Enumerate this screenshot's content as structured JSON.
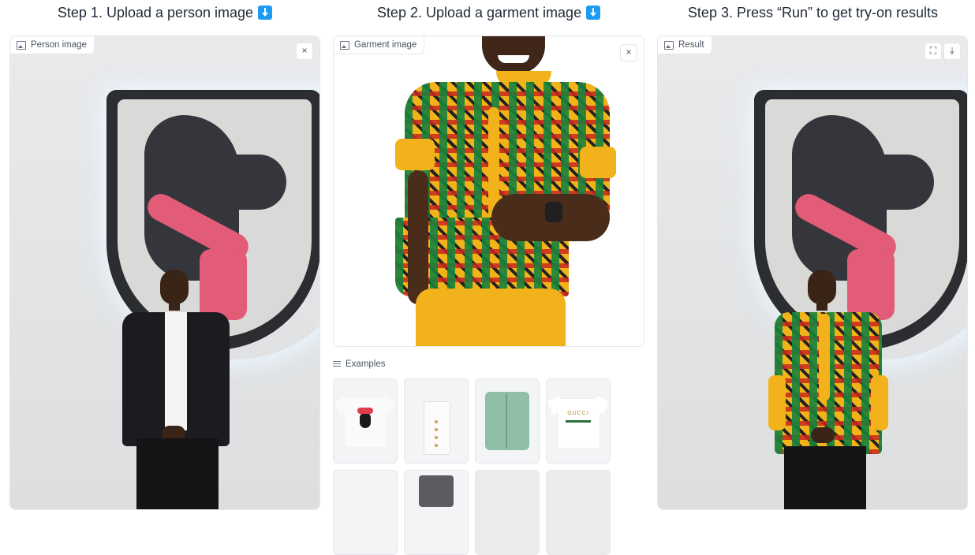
{
  "steps": [
    {
      "title": "Step 1. Upload a person image",
      "icon": "down-arrow-icon"
    },
    {
      "title": "Step 2. Upload a garment image",
      "icon": "down-arrow-icon"
    },
    {
      "title": "Step 3. Press “Run” to get try-on results"
    }
  ],
  "person_panel": {
    "label": "Person image",
    "action": "close-icon",
    "action_glyph": "×"
  },
  "garment_panel": {
    "label": "Garment image",
    "action": "close-icon",
    "action_glyph": "×"
  },
  "result_panel": {
    "label": "Result",
    "actions": [
      {
        "icon": "fullscreen-icon",
        "glyph": "⛶"
      },
      {
        "icon": "download-icon",
        "glyph": "⤓"
      }
    ]
  },
  "examples": {
    "label": "Examples",
    "gucci_logo_text": "GUCCI",
    "items": [
      {
        "name": "minnie-mouse-tshirt"
      },
      {
        "name": "white-button-tank-top"
      },
      {
        "name": "green-denim-jacket"
      },
      {
        "name": "gucci-logo-tshirt"
      },
      {
        "name": "white-item"
      },
      {
        "name": "gray-sleeveless-top"
      },
      {
        "name": "loading-placeholder"
      },
      {
        "name": "loading-placeholder"
      }
    ]
  },
  "colors": {
    "accent_badge": "#1d9bf0",
    "border": "#e5e7eb",
    "label_text": "#4b5563"
  }
}
